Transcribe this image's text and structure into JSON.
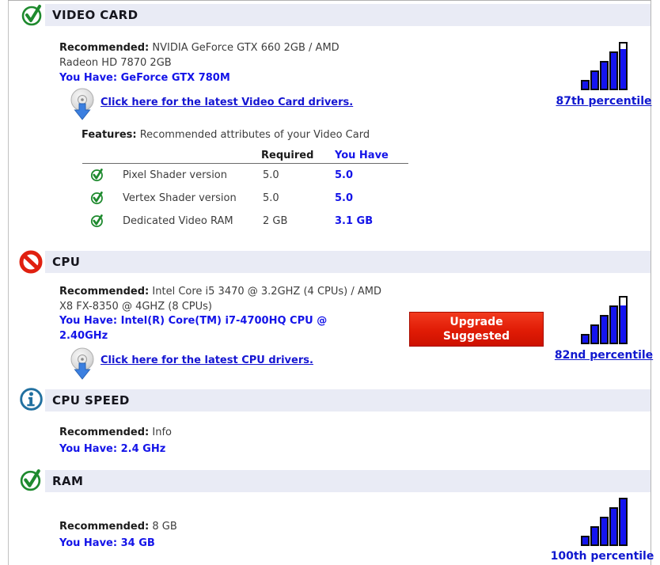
{
  "sections": [
    {
      "title": "VIDEO CARD",
      "status": "pass",
      "recommended_label": "Recommended:",
      "recommended_text": "NVIDIA GeForce GTX 660 2GB / AMD Radeon HD 7870 2GB",
      "you_have_label": "You Have:",
      "you_have_text": "GeForce GTX 780M",
      "driver_link": "Click here for the latest Video Card drivers.",
      "percentile": {
        "percent": 87,
        "label": "87th percentile"
      },
      "features": {
        "label": "Features:",
        "description": "Recommended attributes of your Video Card",
        "col_required": "Required",
        "col_you_have": "You Have",
        "rows": [
          {
            "status": "pass",
            "name": "Pixel Shader version",
            "required": "5.0",
            "you_have": "5.0"
          },
          {
            "status": "pass",
            "name": "Vertex Shader version",
            "required": "5.0",
            "you_have": "5.0"
          },
          {
            "status": "pass",
            "name": "Dedicated Video RAM",
            "required": "2 GB",
            "you_have": "3.1 GB"
          }
        ]
      }
    },
    {
      "title": "CPU",
      "status": "fail",
      "recommended_label": "Recommended:",
      "recommended_text": "Intel Core i5 3470 @ 3.2GHZ (4 CPUs) / AMD X8 FX-8350 @ 4GHZ (8 CPUs)",
      "you_have_label": "You Have:",
      "you_have_text": "Intel(R) Core(TM) i7-4700HQ CPU @ 2.40GHz",
      "driver_link": "Click here for the latest CPU drivers.",
      "upgrade_button": "Upgrade Suggested",
      "percentile": {
        "percent": 82,
        "label": "82nd percentile"
      }
    },
    {
      "title": "CPU SPEED",
      "status": "info",
      "recommended_label": "Recommended:",
      "recommended_text": "Info",
      "you_have_label": "You Have:",
      "you_have_text": "2.4 GHz"
    },
    {
      "title": "RAM",
      "status": "pass",
      "recommended_label": "Recommended:",
      "recommended_text": "8 GB",
      "you_have_label": "You Have:",
      "you_have_text": "34 GB",
      "percentile": {
        "percent": 100,
        "label": "100th percentile"
      }
    }
  ],
  "colors": {
    "header_band": "#e9ebf5",
    "accent_blue": "#1414e8",
    "link_blue": "#1515d2",
    "percentile_blue": "#1018cf",
    "bar_blue": "#1414f0",
    "pass_green": "#1e8a2e",
    "fail_red": "#e02010",
    "info_blue": "#2170a0",
    "button_red": "#e01b05"
  }
}
